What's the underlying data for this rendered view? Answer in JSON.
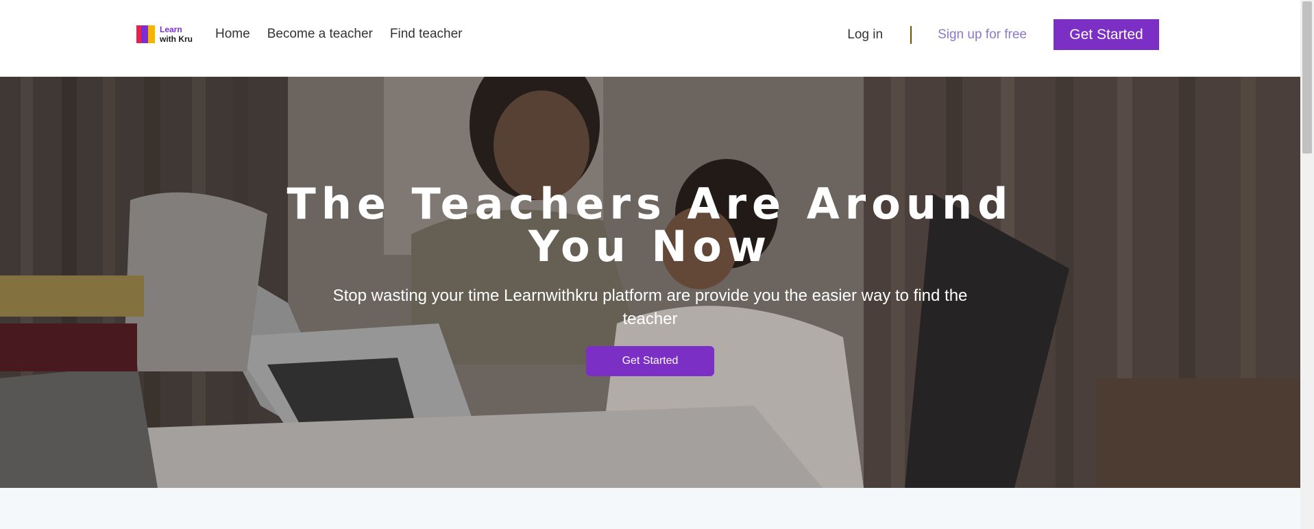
{
  "logo": {
    "line1": "Learn",
    "line2": "with Kru",
    "colors": [
      "#e8204a",
      "#7b2fd0",
      "#f5b400"
    ]
  },
  "nav": {
    "items": [
      "Home",
      "Become a teacher",
      "Find teacher"
    ]
  },
  "auth": {
    "login": "Log in",
    "signup": "Sign up for free",
    "get_started": "Get Started"
  },
  "hero": {
    "title": "The Teachers Are Around You Now",
    "subtitle": "Stop wasting your time Learnwithkru platform are provide you the easier way to find the teacher",
    "cta": "Get Started"
  },
  "colors": {
    "accent": "#7b2fc4",
    "signup": "#8b78c6",
    "section_bg": "#f5f8fb"
  }
}
